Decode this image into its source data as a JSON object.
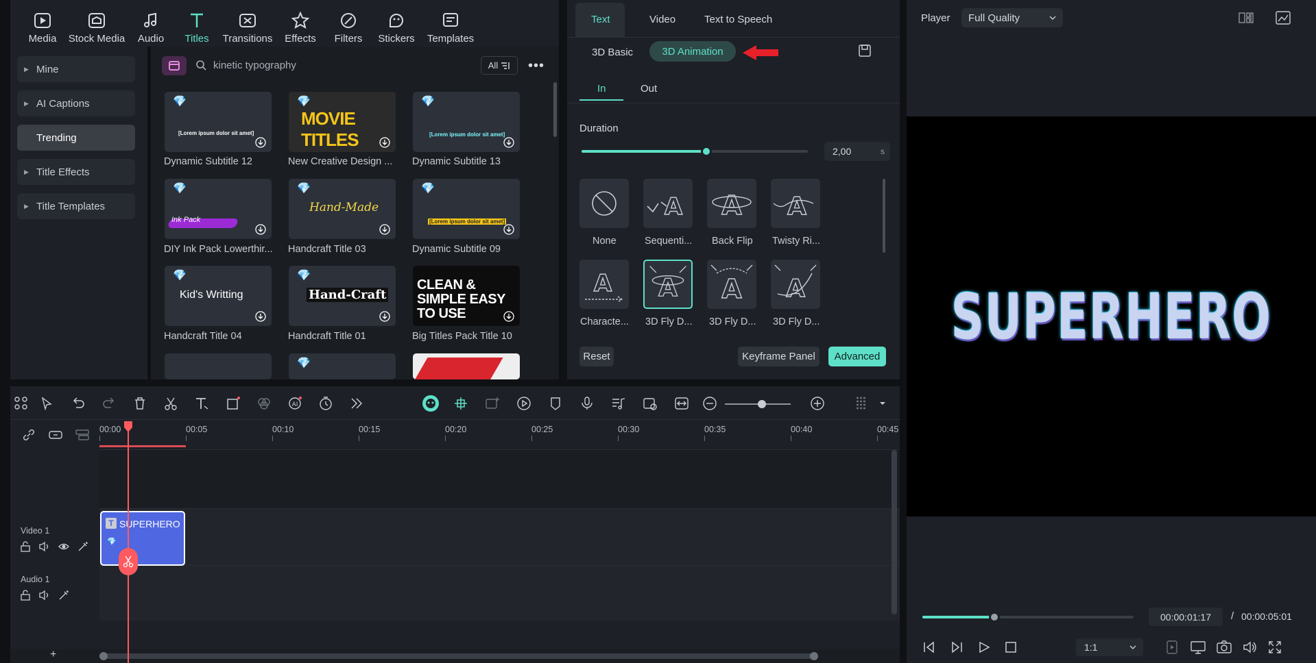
{
  "library": {
    "tabs": [
      {
        "label": "Media",
        "icon": "media-icon"
      },
      {
        "label": "Stock Media",
        "icon": "stock-media-icon"
      },
      {
        "label": "Audio",
        "icon": "audio-icon"
      },
      {
        "label": "Titles",
        "icon": "titles-icon",
        "active": true
      },
      {
        "label": "Transitions",
        "icon": "transitions-icon"
      },
      {
        "label": "Effects",
        "icon": "effects-icon"
      },
      {
        "label": "Filters",
        "icon": "filters-icon"
      },
      {
        "label": "Stickers",
        "icon": "stickers-icon"
      },
      {
        "label": "Templates",
        "icon": "templates-icon"
      }
    ],
    "sidebar": [
      {
        "label": "Mine"
      },
      {
        "label": "AI Captions"
      },
      {
        "label": "Trending"
      },
      {
        "label": "Title Effects"
      },
      {
        "label": "Title Templates"
      }
    ],
    "search": {
      "value": "kinetic typography",
      "filter_label": "All"
    },
    "items": [
      {
        "label": "Dynamic Subtitle 12",
        "thumb_text": "[Lorem ipsum dolor sit amet]"
      },
      {
        "label": "New Creative Design ...",
        "thumb_text": "MOVIE TITLES"
      },
      {
        "label": "Dynamic Subtitle 13",
        "thumb_text": "[Lorem ipsum dolor sit amet]"
      },
      {
        "label": "DIY Ink Pack Lowerthir...",
        "thumb_text": "Ink Pack"
      },
      {
        "label": "Handcraft Title 03",
        "thumb_text": "Hand-Made"
      },
      {
        "label": "Dynamic Subtitle 09",
        "thumb_text": "[Lorem ipsum dolor sit amet]"
      },
      {
        "label": "Handcraft Title 04",
        "thumb_text": "Kid's Writting"
      },
      {
        "label": "Handcraft Title 01",
        "thumb_text": "Hand-Craft"
      },
      {
        "label": "Big Titles Pack Title 10",
        "thumb_text": "CLEAN & SIMPLE EASY TO USE"
      }
    ]
  },
  "props": {
    "tabs": [
      "Text",
      "Video",
      "Text to Speech"
    ],
    "subtabs": [
      "3D Basic",
      "3D Animation"
    ],
    "inout": [
      "In",
      "Out"
    ],
    "duration_label": "Duration",
    "duration_value": "2,00",
    "duration_unit": "s",
    "duration_fraction": 0.55,
    "animations": [
      {
        "label": "None",
        "icon": "none-icon"
      },
      {
        "label": "Sequenti...",
        "icon": "sequential-icon"
      },
      {
        "label": "Back Flip",
        "icon": "back-flip-icon"
      },
      {
        "label": "Twisty Ri...",
        "icon": "twisty-icon"
      },
      {
        "label": "Characte...",
        "icon": "character-icon"
      },
      {
        "label": "3D Fly D...",
        "icon": "fly-icon",
        "selected": true
      },
      {
        "label": "3D Fly D...",
        "icon": "fly-icon"
      },
      {
        "label": "3D Fly D...",
        "icon": "fly-icon"
      }
    ],
    "buttons": {
      "reset": "Reset",
      "keyframe": "Keyframe Panel",
      "advanced": "Advanced"
    }
  },
  "player": {
    "label": "Player",
    "quality": "Full Quality",
    "preview_text": "SUPERHERO",
    "current_time": "00:00:01:17",
    "separator": "/",
    "total_time": "00:00:05:01",
    "ratio": "1:1",
    "progress": 0.34
  },
  "timeline": {
    "ticks": [
      "00:00",
      "00:05",
      "00:10",
      "00:15",
      "00:20",
      "00:25",
      "00:30",
      "00:35",
      "00:40",
      "00:45"
    ],
    "tracks": [
      {
        "label": "Video 1"
      },
      {
        "label": "Audio 1"
      }
    ],
    "clip_label": "SUPERHERO",
    "add_label": "+"
  },
  "colors": {
    "accent": "#5ee0c8",
    "playhead": "#ff5a5f",
    "clip": "#4f67e0",
    "arrow": "#e8202a"
  }
}
